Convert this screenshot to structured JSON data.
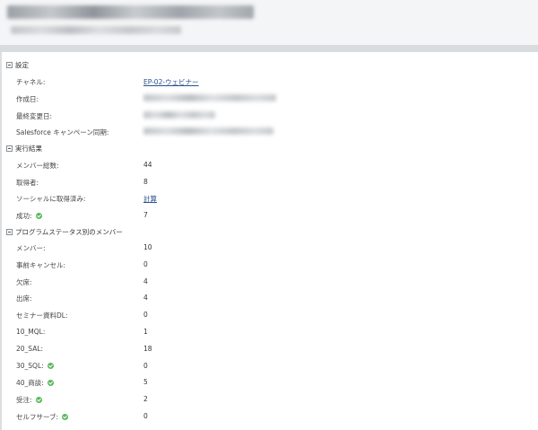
{
  "sections": {
    "settings": "設定",
    "results": "実行結果",
    "program_status": "プログラムステータス別のメンバー"
  },
  "settings": {
    "channel_label": "チャネル:",
    "channel_value": "EP-02-ウェビナー",
    "created_label": "作成日:",
    "modified_label": "最終変更日:",
    "salesforce_label": "Salesforce キャンペーン同期:"
  },
  "results": {
    "members_label": "メンバー総数:",
    "members_value": "44",
    "acquired_label": "取得者:",
    "acquired_value": "8",
    "social_label": "ソーシャルに取得済み:",
    "social_value": "計算",
    "success_label": "成功:",
    "success_value": "7"
  },
  "statuses": [
    {
      "label": "メンバー:",
      "value": "10",
      "success": false
    },
    {
      "label": "事前キャンセル:",
      "value": "0",
      "success": false
    },
    {
      "label": "欠席:",
      "value": "4",
      "success": false
    },
    {
      "label": "出席:",
      "value": "4",
      "success": false
    },
    {
      "label": "セミナー資料DL:",
      "value": "0",
      "success": false
    },
    {
      "label": "10_MQL:",
      "value": "1",
      "success": false
    },
    {
      "label": "20_SAL:",
      "value": "18",
      "success": false
    },
    {
      "label": "30_SQL:",
      "value": "0",
      "success": true
    },
    {
      "label": "40_商談:",
      "value": "5",
      "success": true
    },
    {
      "label": "受注:",
      "value": "2",
      "success": true
    },
    {
      "label": "セルフサーブ:",
      "value": "0",
      "success": true
    }
  ],
  "colors": {
    "link": "#2a4f8f",
    "success_icon": "#5cb85c",
    "header_bg": "#f4f5f6",
    "band": "#d9dcdf"
  },
  "icons": {
    "section_toggle": "collapse-minus-icon",
    "success": "success-check-icon"
  }
}
